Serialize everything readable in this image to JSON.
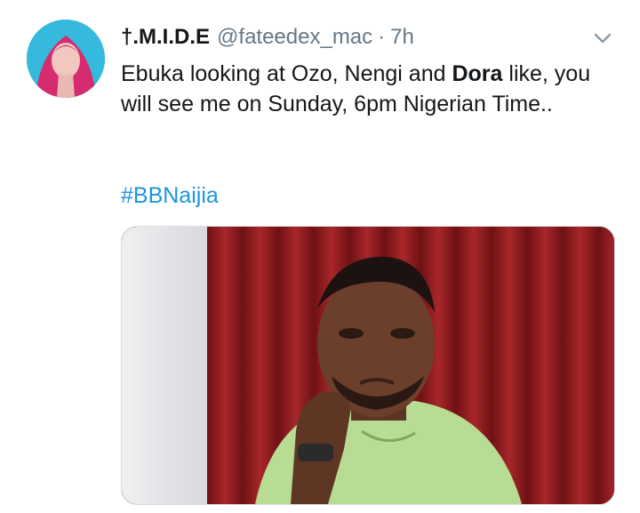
{
  "tweet": {
    "display_name": "†.M.I.D.E",
    "handle": "@fateedex_mac",
    "separator": "·",
    "time": "7h",
    "text_before_bold": "Ebuka looking at Ozo, Nengi and ",
    "text_bold": "Dora",
    "text_after_bold": " like, you will see me on Sunday, 6pm Nigerian Time..",
    "hashtag": "#BBNaijia"
  },
  "icons": {
    "menu": "chevron-down-icon"
  },
  "colors": {
    "link": "#1b95e0",
    "meta": "#657786",
    "text": "#14171a"
  }
}
